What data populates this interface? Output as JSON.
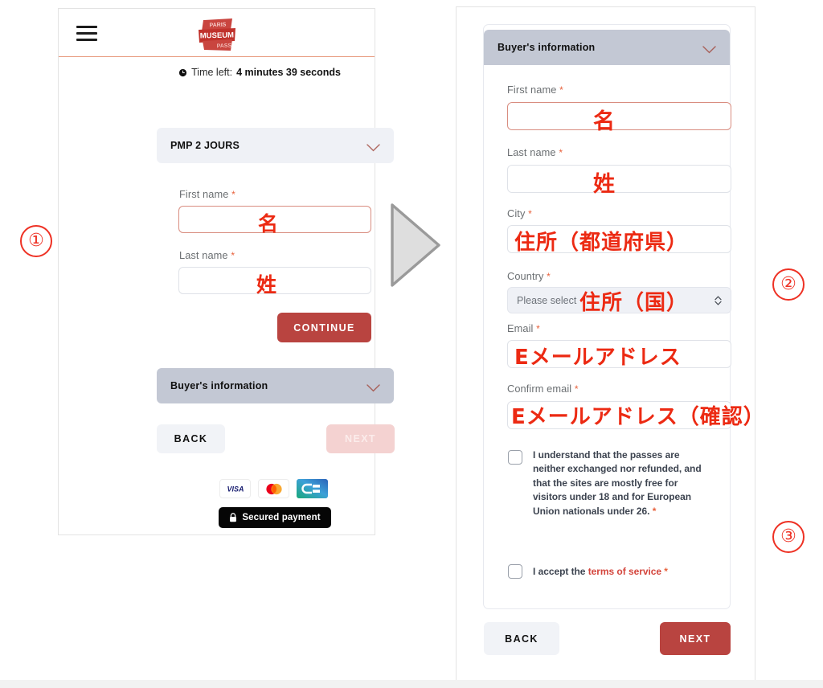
{
  "left_phone": {
    "header": {
      "menu_icon": "hamburger-menu-icon",
      "logo_line1": "PARIS",
      "logo_line2": "MUSEUM",
      "logo_line3": "PASS"
    },
    "timer": {
      "icon": "clock-icon",
      "label": "Time left:",
      "value": "4 minutes 39 seconds"
    },
    "product_accordion": {
      "title": "PMP 2 JOURS",
      "chevron": "chevron-down-icon"
    },
    "fields": [
      {
        "label": "First name",
        "required": "*",
        "annotation": "名",
        "focused": true
      },
      {
        "label": "Last name",
        "required": "*",
        "annotation": "姓",
        "focused": false
      }
    ],
    "continue_button": "CONTINUE",
    "buyer_accordion": {
      "title": "Buyer's information",
      "chevron": "chevron-down-icon"
    },
    "back_button": "BACK",
    "next_button": "NEXT",
    "payment": {
      "cards": [
        "VISA",
        "mastercard",
        "CB"
      ],
      "secured_label": "Secured payment",
      "lock_icon": "lock-icon"
    }
  },
  "right_phone": {
    "buyer_accordion": {
      "title": "Buyer's information",
      "chevron": "chevron-down-icon"
    },
    "fields": [
      {
        "label": "First name",
        "required": "*",
        "annotation": "名",
        "type": "text",
        "focused": true
      },
      {
        "label": "Last name",
        "required": "*",
        "annotation": "姓",
        "type": "text",
        "focused": false
      },
      {
        "label": "City",
        "required": "*",
        "annotation": "住所（都道府県）",
        "type": "text",
        "focused": false
      },
      {
        "label": "Country",
        "required": "*",
        "annotation": "住所（国）",
        "type": "select",
        "placeholder": "Please select",
        "focused": false
      },
      {
        "label": "Email",
        "required": "*",
        "annotation": "Eメールアドレス",
        "type": "text",
        "focused": false
      },
      {
        "label": "Confirm email",
        "required": "*",
        "annotation": "Eメールアドレス（確認）",
        "type": "text",
        "focused": false
      }
    ],
    "checkboxes": [
      {
        "text": "I understand that the passes are neither exchanged nor refunded, and that the sites are mostly free for visitors under 18 and for European Union nationals under 26.",
        "required": "*",
        "checked": false
      },
      {
        "text_before": "I accept the ",
        "link": "terms of service",
        "required": "*",
        "checked": false
      }
    ],
    "back_button": "BACK",
    "next_button": "NEXT"
  },
  "annotations": {
    "step1": "①",
    "step2": "②",
    "step3": "③",
    "arrow": "right-arrow-shape"
  },
  "colors": {
    "brand_red": "#b94440",
    "annotation_red": "#ec2a13",
    "accordion_grey": "#c3c8d4",
    "accordion_light": "#eff1f6",
    "required_star": "#e8613c"
  }
}
